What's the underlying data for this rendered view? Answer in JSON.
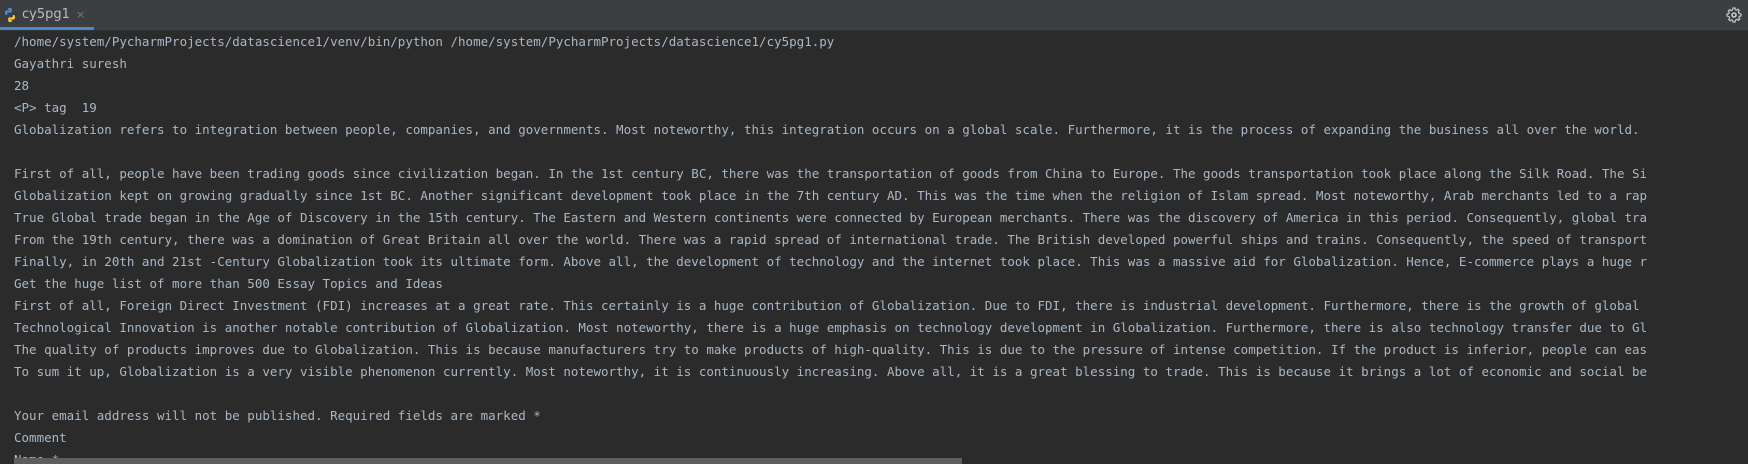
{
  "tab": {
    "label": "cy5pg1",
    "close": "×"
  },
  "colors": {
    "background": "#2b2b2b",
    "tabbar": "#3c3f41",
    "tab_underline": "#4a88c7",
    "text": "#a9b7c6"
  },
  "console": {
    "lines": [
      "/home/system/PycharmProjects/datascience1/venv/bin/python /home/system/PycharmProjects/datascience1/cy5pg1.py",
      "Gayathri suresh",
      "28",
      "<P> tag  19",
      "Globalization refers to integration between people, companies, and governments. Most noteworthy, this integration occurs on a global scale. Furthermore, it is the process of expanding the business all over the world.",
      "",
      "First of all, people have been trading goods since civilization began. In the 1st century BC, there was the transportation of goods from China to Europe. The goods transportation took place along the Silk Road. The Si",
      "Globalization kept on growing gradually since 1st BC. Another significant development took place in the 7th century AD. This was the time when the religion of Islam spread. Most noteworthy, Arab merchants led to a rap",
      "True Global trade began in the Age of Discovery in the 15th century. The Eastern and Western continents were connected by European merchants. There was the discovery of America in this period. Consequently, global tra",
      "From the 19th century, there was a domination of Great Britain all over the world. There was a rapid spread of international trade. The British developed powerful ships and trains. Consequently, the speed of transport",
      "Finally, in 20th and 21st -Century Globalization took its ultimate form. Above all, the development of technology and the internet took place. This was a massive aid for Globalization. Hence, E-commerce plays a huge r",
      "Get the huge list of more than 500 Essay Topics and Ideas",
      "First of all, Foreign Direct Investment (FDI) increases at a great rate. This certainly is a huge contribution of Globalization. Due to FDI, there is industrial development. Furthermore, there is the growth of global",
      "Technological Innovation is another notable contribution of Globalization. Most noteworthy, there is a huge emphasis on technology development in Globalization. Furthermore, there is also technology transfer due to Gl",
      "The quality of products improves due to Globalization. This is because manufacturers try to make products of high-quality. This is due to the pressure of intense competition. If the product is inferior, people can eas",
      "To sum it up, Globalization is a very visible phenomenon currently. Most noteworthy, it is continuously increasing. Above all, it is a great blessing to trade. This is because it brings a lot of economic and social be",
      "",
      "Your email address will not be published. Required fields are marked *",
      "Comment",
      "Name *"
    ]
  }
}
